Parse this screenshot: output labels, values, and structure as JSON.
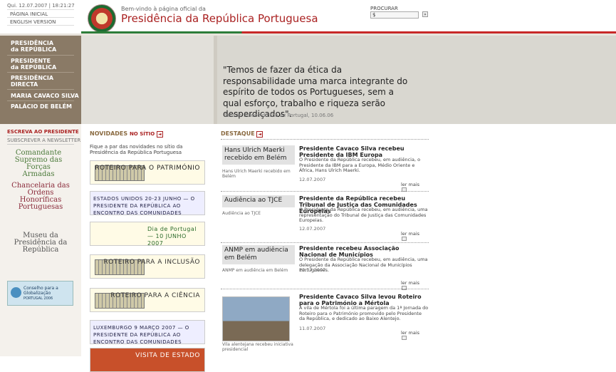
{
  "header": {
    "datetime": "Qui. 12.07.2007 | 18:21:27",
    "home_link": "PÁGINA INICIAL",
    "english_link": "ENGLISH VERSION",
    "welcome": "Bem-vindo à página oficial da",
    "site_name": "Presidência da República Portuguesa",
    "search_label": "PROCURAR",
    "search_value": "$"
  },
  "nav": {
    "items": [
      {
        "l1": "PRESIDÊNCIA",
        "l2": "da REPÚBLICA"
      },
      {
        "l1": "PRESIDENTE",
        "l2": "da REPÚBLICA"
      },
      {
        "l1": "PRESIDÊNCIA",
        "l2": "DIRECTA"
      },
      {
        "l1": "MARIA CAVACO SILVA",
        "l2": ""
      },
      {
        "l1": "PALÁCIO DE BELÉM",
        "l2": ""
      }
    ]
  },
  "hero": {
    "quote": "\"Temos de fazer da ética da responsabilidade uma marca integrante do espírito de todos os Portugueses, sem a qual esforço, trabalho e riqueza serão desperdiçados\".",
    "source": "Sessão Solene do Dia de Portugal, 10.06.06"
  },
  "sidebar": {
    "write": "ESCREVA AO PRESIDENTE",
    "newsletter": "SUBSCREVER A NEWSLETTER",
    "logo1": "Comandante Supremo das Forças Armadas",
    "logo2": "Chancelaria das Ordens Honoríficas Portuguesas",
    "logo3": "Museu da Presidência da República",
    "conselho": "Conselho para a Globalização",
    "conselho_sub": "PORTUGAL 2006"
  },
  "novidades": {
    "title": "NOVIDADES",
    "title_suffix": "NO SÍTIO",
    "desc": "Fique a par das novidades no sítio da Presidência da República Portuguesa",
    "banners": [
      {
        "text": "ROTEIRO PARA O PATRIMÓNIO"
      },
      {
        "text": "ESTADOS UNIDOS 20-23 JUNHO — O PRESIDENTE DA REPÚBLICA AO ENCONTRO DAS COMUNIDADES PORTUGUESAS"
      },
      {
        "text": "Dia de Portugal — 10 JUNHO 2007"
      },
      {
        "text": "ROTEIRO PARA A INCLUSÃO"
      },
      {
        "text": "ROTEIRO PARA A CIÊNCIA"
      },
      {
        "text": "LUXEMBURGO 9 MARÇO 2007 — O PRESIDENTE DA REPÚBLICA AO ENCONTRO DAS COMUNIDADES PORTUGUESAS"
      },
      {
        "text": "VISITA DE ESTADO"
      }
    ]
  },
  "destaque": {
    "title": "DESTAQUE",
    "more": "ler mais",
    "items": [
      {
        "img_alt": "Hans Ulrich Maerki recebido em Belém",
        "caption": "Hans Ulrich Maerki recebido em Belém",
        "title": "Presidente Cavaco Silva recebeu Presidente da IBM Europa",
        "body": "O Presidente da República recebeu, em audiência, o Presidente da IBM para a Europa, Médio Oriente e África, Hans Ulrich Maerki.",
        "date": "12.07.2007"
      },
      {
        "img_alt": "Audiência ao TJCE",
        "caption": "Audiência ao TJCE",
        "title": "Presidente da República recebeu Tribunal de Justiça das Comunidades Europeias",
        "body": "O Presidente da República recebeu, em audiência, uma representação do Tribunal de Justiça das Comunidades Europeias.",
        "date": "12.07.2007"
      },
      {
        "img_alt": "ANMP em audiência em Belém",
        "caption": "ANMP em audiência em Belém",
        "title": "Presidente recebeu Associação Nacional de Municípios",
        "body": "O Presidente da República recebeu, em audiência, uma delegação da Associação Nacional de Municípios Portugueses.",
        "date": "12.07.2007"
      },
      {
        "img_alt": "",
        "caption": "Vila alentejana recebeu iniciativa presidencial",
        "title": "Presidente Cavaco Silva levou Roteiro para o Património a Mértola",
        "body": "A vila de Mértola foi a última paragem da 1ª Jornada do Roteiro para o Património promovido pelo Presidente da República, e dedicado ao Baixo Alentejo.",
        "date": "11.07.2007"
      }
    ]
  }
}
